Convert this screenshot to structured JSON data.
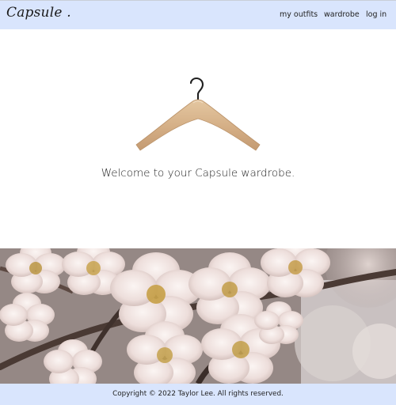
{
  "navbar": {
    "brand": "Capsule .",
    "links": [
      {
        "label": "my outfits"
      },
      {
        "label": "wardrobe"
      },
      {
        "label": "log in"
      }
    ]
  },
  "hero": {
    "welcome": "Welcome to your Capsule wardrobe.",
    "image_icon": "hanger-icon"
  },
  "banner": {
    "image": "cherry-blossom-photo"
  },
  "footer": {
    "copyright": "Copyright © 2022 Taylor Lee. All rights reserved."
  },
  "colors": {
    "nav_background": "#d9e5fd",
    "footer_background": "#d9e5fd",
    "hanger_wood": "#d7b38c"
  }
}
